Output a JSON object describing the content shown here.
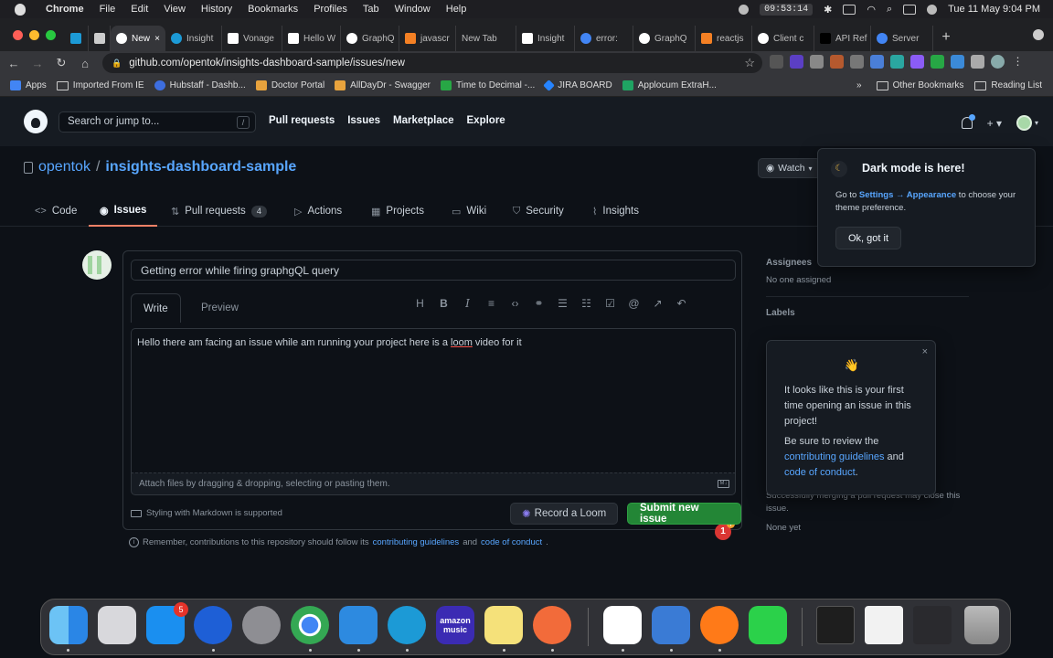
{
  "menubar": {
    "app": "Chrome",
    "items": [
      "File",
      "Edit",
      "View",
      "History",
      "Bookmarks",
      "Profiles",
      "Tab",
      "Window",
      "Help"
    ],
    "clock": "09:53:14",
    "datetime": "Tue 11 May  9:04 PM"
  },
  "tabs": [
    {
      "label": "New"
    },
    {
      "label": "Insight"
    },
    {
      "label": "Vonage"
    },
    {
      "label": "Hello W"
    },
    {
      "label": "GraphQ"
    },
    {
      "label": "javascr"
    },
    {
      "label": "New Tab"
    },
    {
      "label": "Insight"
    },
    {
      "label": "error: "
    },
    {
      "label": "GraphQ"
    },
    {
      "label": "reactjs"
    },
    {
      "label": "Client c"
    },
    {
      "label": "API Ref"
    },
    {
      "label": "Server"
    }
  ],
  "address": {
    "url": "github.com/opentok/insights-dashboard-sample/issues/new"
  },
  "bookmarks": {
    "items": [
      "Apps",
      "Imported From IE",
      "Hubstaff - Dashb...",
      "Doctor Portal",
      "AllDayDr - Swagger",
      "Time to Decimal -...",
      "JIRA BOARD",
      "Applocum ExtraH..."
    ],
    "more": "»",
    "other": "Other Bookmarks",
    "reading": "Reading List"
  },
  "github": {
    "search_placeholder": "Search or jump to...",
    "search_key": "/",
    "nav": [
      "Pull requests",
      "Issues",
      "Marketplace",
      "Explore"
    ],
    "plus": "+ ▾"
  },
  "repo": {
    "owner": "opentok",
    "separator": "/",
    "name": "insights-dashboard-sample",
    "watch_label": "Watch",
    "tabs": [
      {
        "label": "Code",
        "icon": "<>"
      },
      {
        "label": "Issues",
        "icon": "◉"
      },
      {
        "label": "Pull requests",
        "icon": "⇅",
        "count": "4"
      },
      {
        "label": "Actions",
        "icon": "▷"
      },
      {
        "label": "Projects",
        "icon": "▦"
      },
      {
        "label": "Wiki",
        "icon": "▭"
      },
      {
        "label": "Security",
        "icon": "⛉"
      },
      {
        "label": "Insights",
        "icon": "⌇"
      }
    ]
  },
  "issue": {
    "title_value": "Getting error while firing graphgQL query",
    "tab_write": "Write",
    "tab_preview": "Preview",
    "body_pre": "Hello there am facing an issue while am running your project here is a ",
    "body_err": "loom",
    "body_post": " video for it",
    "badge_count": "1",
    "attach_hint": "Attach files by dragging & dropping, selecting or pasting them.",
    "markdown_note": "Styling with Markdown is supported",
    "loom_button": "Record a Loom",
    "submit_button": "Submit new issue",
    "remember_pre": "Remember, contributions to this repository should follow its ",
    "remember_link1": "contributing guidelines",
    "remember_mid": " and ",
    "remember_link2": "code of conduct",
    "remember_post": "."
  },
  "sidebar": {
    "assignees_label": "Assignees",
    "assignees_value": "No one assigned",
    "labels_label": "Labels",
    "linked_value": "Successfully merging a pull request may close this issue.",
    "milestone_value": "None yet"
  },
  "popover_dark": {
    "heading": "Dark mode is here!",
    "text_pre": "Go to ",
    "text_link": "Settings → Appearance",
    "text_post": " to choose your theme preference.",
    "button": "Ok, got it"
  },
  "popover_first": {
    "close": "×",
    "wave": "👋",
    "line1": "It looks like this is your first time opening an issue in this project!",
    "line2_pre": "Be sure to review the ",
    "link1": "contributing guidelines",
    "line2_mid": " and ",
    "link2": "code of conduct",
    "line2_post": "."
  },
  "dock": {
    "appstore_badge": "5",
    "amazon_label": "amazon music"
  },
  "colors": {
    "accent": "#58a6ff",
    "submit": "#238636",
    "active_tab_underline": "#f78166"
  }
}
